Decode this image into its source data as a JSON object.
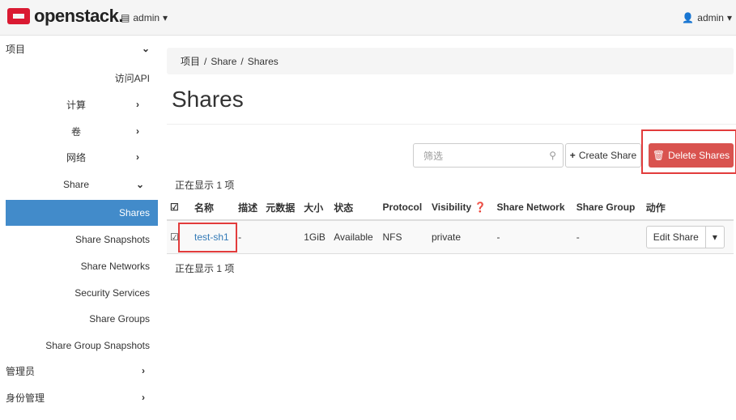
{
  "topbar": {
    "logo_text": "openstack",
    "project_menu": "admin",
    "user_menu": "admin"
  },
  "sidebar": {
    "items": [
      {
        "label": "项目"
      },
      {
        "label": "访问API"
      },
      {
        "label": "计算"
      },
      {
        "label": "卷"
      },
      {
        "label": "网络"
      },
      {
        "label": "Share"
      },
      {
        "label": "Shares"
      },
      {
        "label": "Share Snapshots"
      },
      {
        "label": "Share Networks"
      },
      {
        "label": "Security Services"
      },
      {
        "label": "Share Groups"
      },
      {
        "label": "Share Group Snapshots"
      },
      {
        "label": "管理员"
      },
      {
        "label": "身份管理"
      }
    ]
  },
  "breadcrumb": {
    "items": [
      "项目",
      "Share",
      "Shares"
    ],
    "separator": "/"
  },
  "page": {
    "title": "Shares",
    "count_top": "正在显示 1 项",
    "count_bottom": "正在显示 1 项"
  },
  "toolbar": {
    "filter_placeholder": "筛选",
    "create_label": "Create Share",
    "delete_label": "Delete Shares"
  },
  "table": {
    "headers": [
      "名称",
      "描述",
      "元数据",
      "大小",
      "状态",
      "Protocol",
      "Visibility",
      "Share Network",
      "Share Group",
      "动作"
    ],
    "rows": [
      {
        "name": "test-sh1",
        "description": "-",
        "metadata": "",
        "size": "1GiB",
        "status": "Available",
        "protocol": "NFS",
        "visibility": "private",
        "share_network": "-",
        "share_group": "-",
        "action": "Edit Share"
      }
    ]
  },
  "colors": {
    "active_nav": "#428bca",
    "delete_button": "#d9534f",
    "highlight_border": "#e23c3c",
    "link": "#337ab7"
  }
}
